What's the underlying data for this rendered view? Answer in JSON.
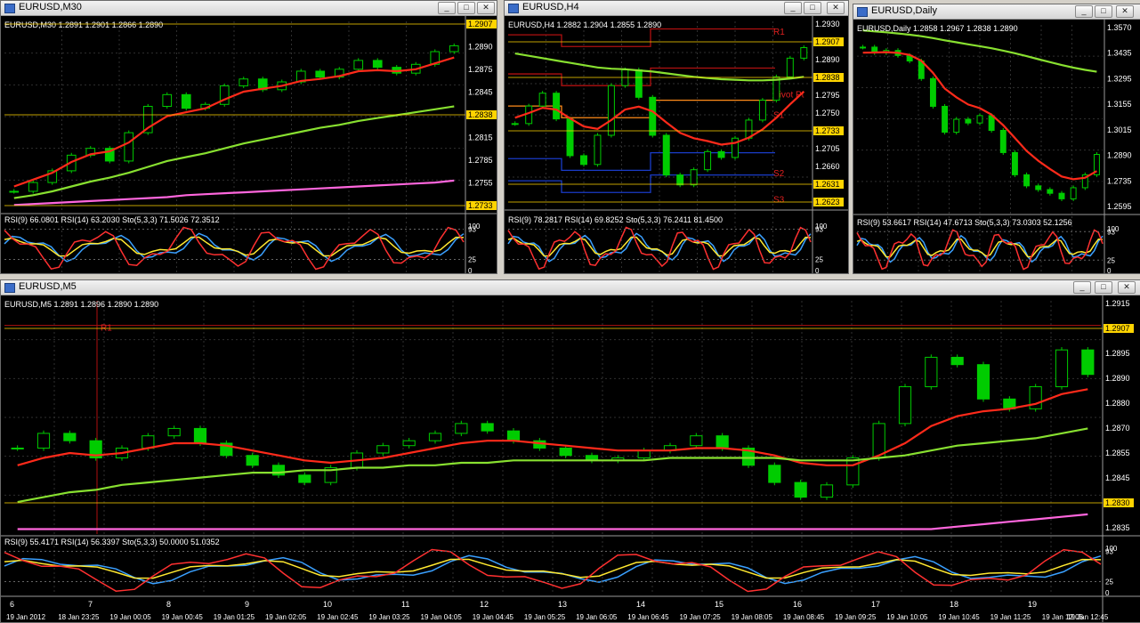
{
  "colors": {
    "bg": "#000000",
    "candle": "#00cc00",
    "grid": "#2f2f2f",
    "ema_fast": "#ff2a1a",
    "ema_mid": "#ff8c1a",
    "ema_slow": "#88e030",
    "ema_long": "#ff66dd",
    "rsi9": "#3aa0ff",
    "rsi14": "#ffe830",
    "stoch": "#ff3030",
    "highlight": "#ffd400"
  },
  "icons": {
    "chart_window": "chart-window-icon",
    "minimize": "minimize-icon",
    "maximize": "maximize-icon",
    "close": "close-icon"
  },
  "windows": [
    {
      "id": "m30",
      "title": "EURUSD,M30",
      "info": "EURUSD,M30  1.2891 1.2901 1.2866 1.2890",
      "rsi_info": "RSI(9) 66.0801  RSI(14) 63.2030  Sto(5,3,3) 71.5026 72.3512",
      "price_labels": [
        "1.2907",
        "1.2890",
        "1.2875",
        "1.2845",
        "1.2838",
        "1.2815",
        "1.2785",
        "1.2755",
        "1.2733"
      ],
      "highlight_labels": [
        "1.2907",
        "1.2838",
        "1.2733"
      ],
      "osc_labels": [
        "100",
        "93",
        "25",
        "0"
      ]
    },
    {
      "id": "h4",
      "title": "EURUSD,H4",
      "info": "EURUSD,H4  1.2882 1.2904 1.2855 1.2890",
      "rsi_info": "RSI(9) 78.2817  RSI(14) 69.8252  Sto(5,3,3) 76.2411 81.4500",
      "price_labels": [
        "1.2930",
        "1.2907",
        "1.2890",
        "1.2838",
        "1.2795",
        "1.2750",
        "1.2733",
        "1.2705",
        "1.2660",
        "1.2631",
        "1.2623"
      ],
      "highlight_labels": [
        "1.2907",
        "1.2838",
        "1.2733",
        "1.2631",
        "1.2623"
      ],
      "pivot_labels": [
        "R1",
        "Pivot Pt",
        "S1",
        "S2",
        "S3"
      ],
      "osc_labels": [
        "100",
        "93",
        "25",
        "0"
      ]
    },
    {
      "id": "d1",
      "title": "EURUSD,Daily",
      "info": "EURUSD,Daily  1.2858 1.2967 1.2838 1.2890",
      "rsi_info": "RSI(9) 53.6617  RSI(14) 47.6713  Sto(5,3,3) 73.0303 52.1256",
      "price_labels": [
        "1.3570",
        "1.3435",
        "1.3295",
        "1.3155",
        "1.3015",
        "1.2890",
        "1.2735",
        "1.2595"
      ],
      "osc_labels": [
        "100",
        "93",
        "25",
        "0"
      ]
    },
    {
      "id": "m5",
      "title": "EURUSD,M5",
      "info": "EURUSD,M5  1.2891 1.2896 1.2890 1.2890",
      "rsi_info": "RSI(9) 55.4171  RSI(14) 56.3397  Sto(5,3,3) 50.0000 51.0352",
      "price_labels": [
        "1.2915",
        "1.2907",
        "1.2895",
        "1.2890",
        "1.2880",
        "1.2870",
        "1.2855",
        "1.2845",
        "1.2830",
        "1.2835"
      ],
      "highlight_labels": [
        "1.2907",
        "1.2830"
      ],
      "pivot_labels": [
        "R1"
      ],
      "osc_labels": [
        "100",
        "93",
        "25",
        "0"
      ],
      "session_numbers": [
        "6",
        "7",
        "8",
        "9",
        "10",
        "11",
        "12",
        "13",
        "14",
        "15",
        "16",
        "17",
        "18",
        "19"
      ],
      "time_labels": [
        "19 Jan 2012",
        "18 Jan 23:25",
        "19 Jan 00:05",
        "19 Jan 00:45",
        "19 Jan 01:25",
        "19 Jan 02:05",
        "19 Jan 02:45",
        "19 Jan 03:25",
        "19 Jan 04:05",
        "19 Jan 04:45",
        "19 Jan 05:25",
        "19 Jan 06:05",
        "19 Jan 06:45",
        "19 Jan 07:25",
        "19 Jan 08:05",
        "19 Jan 08:45",
        "19 Jan 09:25",
        "19 Jan 10:05",
        "19 Jan 10:45",
        "19 Jan 11:25",
        "19 Jan 12:05",
        "19 Jan 12:45"
      ]
    }
  ],
  "chart_data": [
    {
      "type": "line",
      "timeframe": "M30",
      "series": [
        {
          "name": "EURUSD,M30",
          "values": [
            1.2741,
            1.275,
            1.2762,
            1.2778,
            1.2785,
            1.2772,
            1.2801,
            1.2828,
            1.284,
            1.2826,
            1.283,
            1.2849,
            1.2856,
            1.2845,
            1.2853,
            1.2864,
            1.2858,
            1.2866,
            1.2875,
            1.2868,
            1.2862,
            1.2871,
            1.2884,
            1.289
          ]
        },
        {
          "name": "EMA fast",
          "values": [
            1.2746,
            1.2753,
            1.276,
            1.2771,
            1.2779,
            1.2782,
            1.2791,
            1.2806,
            1.2818,
            1.2822,
            1.2826,
            1.2835,
            1.2843,
            1.2846,
            1.2849,
            1.2854,
            1.2856,
            1.2859,
            1.2864,
            1.2865,
            1.2864,
            1.2866,
            1.2872,
            1.2878
          ]
        },
        {
          "name": "EMA slow",
          "values": [
            1.2734,
            1.2737,
            1.2741,
            1.2746,
            1.2751,
            1.2755,
            1.276,
            1.2766,
            1.2772,
            1.2776,
            1.278,
            1.2785,
            1.279,
            1.2794,
            1.2798,
            1.2802,
            1.2806,
            1.2809,
            1.2813,
            1.2816,
            1.2819,
            1.2822,
            1.2825,
            1.2828
          ]
        },
        {
          "name": "EMA long",
          "values": [
            1.2727,
            1.2728,
            1.2729,
            1.273,
            1.2731,
            1.2732,
            1.2733,
            1.2734,
            1.2735,
            1.2737,
            1.2738,
            1.2739,
            1.274,
            1.2741,
            1.2742,
            1.2743,
            1.2744,
            1.2745,
            1.2746,
            1.2747,
            1.2748,
            1.2749,
            1.275,
            1.2752
          ]
        }
      ],
      "ylim": [
        1.272,
        1.2915
      ]
    },
    {
      "type": "line",
      "timeframe": "H4",
      "series": [
        {
          "name": "EURUSD,H4",
          "values": [
            1.276,
            1.279,
            1.2812,
            1.2768,
            1.2705,
            1.269,
            1.274,
            1.2825,
            1.2852,
            1.2805,
            1.274,
            1.2672,
            1.2655,
            1.2681,
            1.2712,
            1.2702,
            1.2735,
            1.2766,
            1.28,
            1.284,
            1.2872,
            1.289
          ]
        },
        {
          "name": "EMA fast",
          "values": [
            1.277,
            1.2778,
            1.2787,
            1.2784,
            1.2769,
            1.2755,
            1.2751,
            1.2766,
            1.2784,
            1.2789,
            1.2781,
            1.2762,
            1.2744,
            1.2735,
            1.273,
            1.2724,
            1.2727,
            1.2736,
            1.275,
            1.277,
            1.2793,
            1.2815
          ]
        },
        {
          "name": "EMA slow",
          "values": [
            1.288,
            1.2876,
            1.2872,
            1.2868,
            1.2864,
            1.286,
            1.2856,
            1.2854,
            1.2853,
            1.2851,
            1.2849,
            1.2846,
            1.2843,
            1.284,
            1.2838,
            1.2836,
            1.2835,
            1.2834,
            1.2834,
            1.2835,
            1.2837,
            1.284
          ]
        }
      ],
      "ylim": [
        1.2615,
        1.2935
      ]
    },
    {
      "type": "line",
      "timeframe": "Daily",
      "series": [
        {
          "name": "EURUSD,Daily",
          "values": [
            1.347,
            1.344,
            1.3452,
            1.3425,
            1.3395,
            1.33,
            1.315,
            1.301,
            1.308,
            1.306,
            1.31,
            1.302,
            1.29,
            1.278,
            1.272,
            1.27,
            1.268,
            1.265,
            1.271,
            1.278,
            1.289
          ]
        },
        {
          "name": "EMA fast",
          "values": [
            1.344,
            1.3441,
            1.3443,
            1.3439,
            1.3428,
            1.3396,
            1.3331,
            1.3246,
            1.3199,
            1.316,
            1.314,
            1.3105,
            1.3048,
            1.2979,
            1.2909,
            1.2856,
            1.2811,
            1.2771,
            1.2756,
            1.2764,
            1.28
          ]
        },
        {
          "name": "EMA slow",
          "values": [
            1.356,
            1.3555,
            1.355,
            1.3544,
            1.3537,
            1.3529,
            1.3519,
            1.3507,
            1.3496,
            1.3485,
            1.3475,
            1.3464,
            1.3451,
            1.3437,
            1.3421,
            1.3405,
            1.3389,
            1.3373,
            1.3359,
            1.3347,
            1.3337
          ]
        }
      ],
      "ylim": [
        1.2575,
        1.359
      ]
    },
    {
      "type": "line",
      "timeframe": "M5",
      "series": [
        {
          "name": "EURUSD,M5",
          "values": [
            1.286,
            1.2866,
            1.2863,
            1.2856,
            1.286,
            1.2865,
            1.2868,
            1.2862,
            1.2857,
            1.2853,
            1.2849,
            1.2846,
            1.2852,
            1.2858,
            1.2861,
            1.2863,
            1.2866,
            1.287,
            1.2867,
            1.2863,
            1.286,
            1.2857,
            1.2855,
            1.2856,
            1.2859,
            1.2861,
            1.2865,
            1.286,
            1.2853,
            1.2846,
            1.284,
            1.2845,
            1.2856,
            1.287,
            1.2885,
            1.2897,
            1.2894,
            1.288,
            1.2876,
            1.2885,
            1.29,
            1.289
          ]
        },
        {
          "name": "EMA fast",
          "values": [
            1.2853,
            1.2856,
            1.2858,
            1.2857,
            1.2858,
            1.286,
            1.2862,
            1.2862,
            1.2861,
            1.2859,
            1.2857,
            1.2855,
            1.2854,
            1.2855,
            1.2856,
            1.2858,
            1.286,
            1.2862,
            1.2863,
            1.2863,
            1.2862,
            1.2861,
            1.286,
            1.2859,
            1.2859,
            1.2859,
            1.286,
            1.286,
            1.2859,
            1.2857,
            1.2854,
            1.2853,
            1.2853,
            1.2857,
            1.2862,
            1.2869,
            1.2873,
            1.2875,
            1.2876,
            1.2878,
            1.2882,
            1.2884
          ]
        },
        {
          "name": "EMA slow",
          "values": [
            1.2838,
            1.284,
            1.2842,
            1.2843,
            1.2845,
            1.2846,
            1.2847,
            1.2848,
            1.2849,
            1.285,
            1.285,
            1.2851,
            1.2851,
            1.2852,
            1.2852,
            1.2853,
            1.2853,
            1.2854,
            1.2854,
            1.2855,
            1.2855,
            1.2855,
            1.2855,
            1.2855,
            1.2855,
            1.2856,
            1.2856,
            1.2856,
            1.2856,
            1.2856,
            1.2855,
            1.2855,
            1.2855,
            1.2856,
            1.2857,
            1.2859,
            1.2861,
            1.2862,
            1.2863,
            1.2864,
            1.2866,
            1.2868
          ]
        },
        {
          "name": "EMA long",
          "values": [
            1.2827,
            1.2827,
            1.2827,
            1.2827,
            1.2827,
            1.2827,
            1.2827,
            1.2827,
            1.2827,
            1.2827,
            1.2827,
            1.2827,
            1.2827,
            1.2827,
            1.2827,
            1.2827,
            1.2827,
            1.2827,
            1.2827,
            1.2827,
            1.2827,
            1.2827,
            1.2827,
            1.2827,
            1.2827,
            1.2827,
            1.2827,
            1.2827,
            1.2827,
            1.2827,
            1.2827,
            1.2827,
            1.2827,
            1.2827,
            1.2827,
            1.2827,
            1.2828,
            1.2829,
            1.283,
            1.2831,
            1.2832,
            1.2833
          ]
        }
      ],
      "ylim": [
        1.2825,
        1.292
      ]
    }
  ]
}
